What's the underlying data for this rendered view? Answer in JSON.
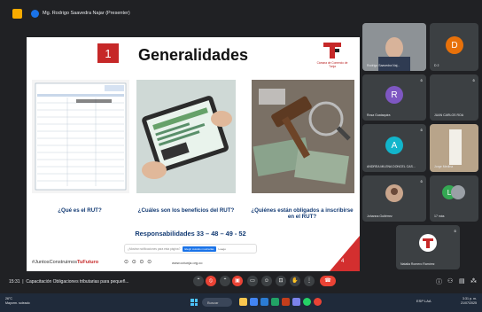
{
  "presenter_bar": {
    "name": "Mg. Rodrigo Saavedra Najar (Presenter)"
  },
  "slide": {
    "number": "1",
    "title": "Generalidades",
    "brand_text": "Cámara de Comercio de Tunja",
    "questions": [
      "¿Qué es el RUT?",
      "¿Cuáles son los beneficios del RUT?",
      "¿Quiénes están obligados a inscribirse en el RUT?"
    ],
    "responsibilities": "Responsabilidades 33 – 48 – 49 - 52",
    "notification": {
      "text": "¿Mostrar notificaciones para esta página?",
      "allow": "Elegir cuándo mostrarlas",
      "block": "Luego"
    },
    "footer_tag_prefix": "#JuntosConstruimos",
    "footer_tag_suffix": "TuFuturo",
    "footer_icons": "⊙ ⊙ ⊙ ⊙",
    "footer_url": "www.cctunja.org.co",
    "page_number": "4"
  },
  "participants": [
    {
      "name": "Rodrigo Saavedra Naj...",
      "initial": "",
      "color": ""
    },
    {
      "name": "D 2",
      "initial": "D",
      "color": "#e8710a"
    },
    {
      "name": "Rosa Guataquira",
      "initial": "R",
      "color": "#7e57c2"
    },
    {
      "name": "JUAN CARLOS ROA",
      "initial": "",
      "color": ""
    },
    {
      "name": "ANDREA MILENA DONCEL CAS...",
      "initial": "A",
      "color": "#12b5cb"
    },
    {
      "name": "Jorge Medina",
      "initial": "",
      "color": ""
    },
    {
      "name": "Johanna Gutiérrez",
      "initial": "",
      "color": ""
    },
    {
      "name": "17 más",
      "initial": "L",
      "color": "#34a853"
    },
    {
      "name": "Natalia Romero Ramírez",
      "initial": "",
      "color": ""
    }
  ],
  "bottom_bar": {
    "time": "15:31",
    "meeting": "Capacitación Obligaciones tributarias para pequeñ..."
  },
  "taskbar": {
    "weather_temp": "26°C",
    "weather_desc": "Mayorm. soleado",
    "search": "Buscar",
    "tray": "ESP LAA",
    "time": "3:31 p. m.",
    "date": "21/07/2025"
  },
  "colors": {
    "accent_red": "#c62828",
    "title_blue": "#123a73",
    "meet_bg": "#202124"
  }
}
